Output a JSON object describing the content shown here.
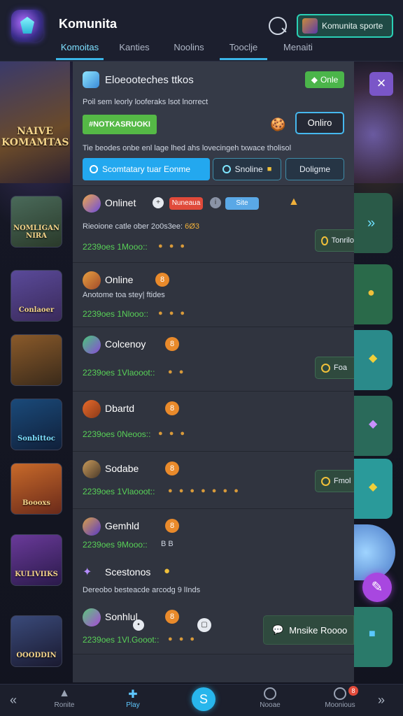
{
  "header": {
    "app_title": "Komunita",
    "community_button": "Komunita sporte",
    "tabs": [
      "Komoitas",
      "Kanties",
      "Noolins",
      "Tooclje",
      "Menaiti"
    ]
  },
  "hero": {
    "title": "Eloeooteches ttkos",
    "badge": "Onle",
    "subtitle": "Poil sem leorly looferaks lsot lnorrect",
    "tag": "#NOTKASRUOKI",
    "online_button": "Onliro",
    "description": "Tie beodes onbe enl lage lhed ahs lovecingeh txwace tholisol",
    "primary_button": "Scomtatary tuar Eonme",
    "secondary_button": "Snoline",
    "tertiary_button": "Doligme"
  },
  "rows": [
    {
      "name": "Onlinet",
      "desc": "Rieoione catle ober 2o0s3ee:",
      "stats": "2239oes 1Mooo::",
      "emojis": "● ● ●",
      "chip_red": "Nuneaua",
      "chip_blue": "Site",
      "action": "Tonrilo",
      "extra": "6Ø3"
    },
    {
      "name": "Online",
      "badge": "8",
      "desc": "Anotome toa stey| ftides",
      "stats": "2239oes 1Nlooo::",
      "emojis": "● ● ●"
    },
    {
      "name": "Colcenoy",
      "badge": "8",
      "stats": "2239oes 1Vlaooot::",
      "emojis": "● ●",
      "action": "Foa"
    },
    {
      "name": "Dbartd",
      "badge": "8",
      "stats": "2239oes 0Neoos::",
      "emojis": "● ● ●"
    },
    {
      "name": "Sodabe",
      "badge": "8",
      "stats": "2239oes 1Vlaooot::",
      "emojis": "● ● ● ● ● ● ●",
      "action": "Fmol"
    },
    {
      "name": "Gemhld",
      "badge": "8",
      "stats": "2239oes 9Mooo::",
      "emojis": "BB"
    },
    {
      "name": "Scestonos",
      "desc": "Dereobo besteacde arcodg 9 lInds"
    },
    {
      "name": "Sonhlul",
      "badge": "8",
      "stats": "2239oes 1Vl.Gooot::",
      "emojis": "● ● ●",
      "message_button": "Mnsike Roooo"
    }
  ],
  "thumbs": [
    "NAIVE KOMAMTAS",
    "NOMLIGAN NIRA",
    "Conlaoer",
    "",
    "Sonbittoc",
    "Boooxs",
    "KULIVIIKS",
    "OOODDIN"
  ],
  "bottom_nav": {
    "items": [
      "Ronite",
      "Play",
      "",
      "Nooae",
      "Moonious"
    ],
    "badge": "8"
  },
  "colors": {
    "accent": "#23a8ef",
    "green": "#55b946",
    "orange": "#e98a2b",
    "panel": "#2e323e"
  }
}
